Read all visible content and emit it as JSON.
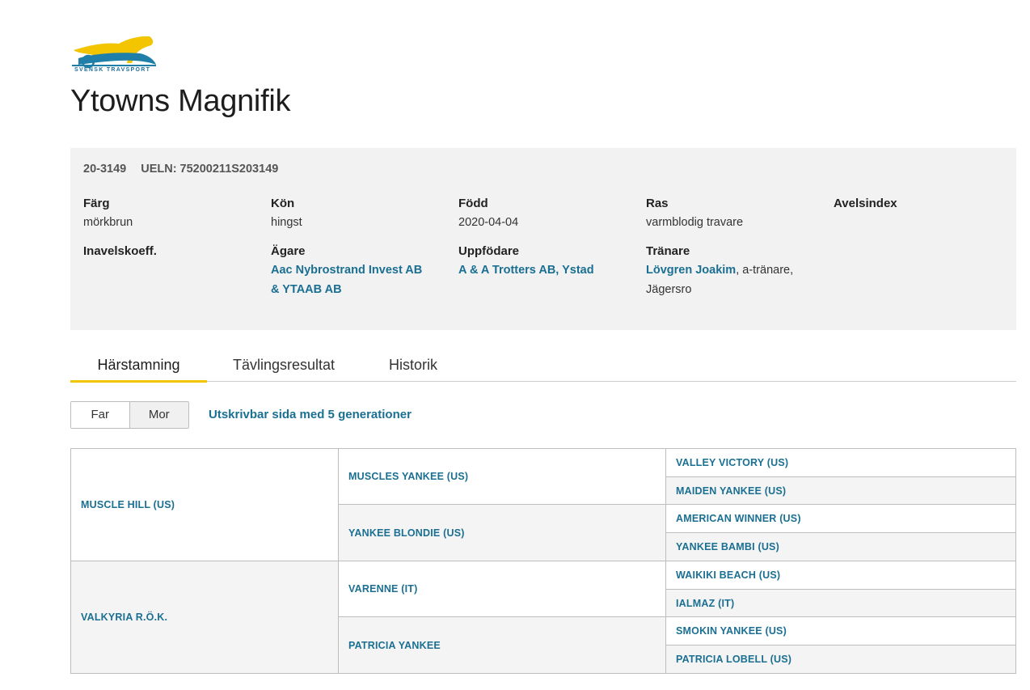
{
  "brand": {
    "logo_text": "SVENSK TRAVSPORT"
  },
  "horse": {
    "name": "Ytowns Magnifik",
    "reg_no": "20-3149",
    "ueln": "UELN: 75200211S203149",
    "fields": {
      "farg": {
        "label": "Färg",
        "value": "mörkbrun"
      },
      "kon": {
        "label": "Kön",
        "value": "hingst"
      },
      "fodd": {
        "label": "Född",
        "value": "2020-04-04"
      },
      "ras": {
        "label": "Ras",
        "value": "varmblodig travare"
      },
      "avelsindex": {
        "label": "Avelsindex"
      },
      "inavel": {
        "label": "Inavelskoeff."
      },
      "agare": {
        "label": "Ägare",
        "line1": "Aac Nybrostrand Invest AB",
        "line2": "& YTAAB AB"
      },
      "uppfodare": {
        "label": "Uppfödare",
        "value": "A & A Trotters AB, Ystad"
      },
      "tranare": {
        "label": "Tränare",
        "link": "Lövgren Joakim",
        "rest1": ", a-tränare,",
        "rest2": "Jägersro"
      }
    }
  },
  "tabs": [
    {
      "label": "Härstamning",
      "active": true
    },
    {
      "label": "Tävlingsresultat",
      "active": false
    },
    {
      "label": "Historik",
      "active": false
    }
  ],
  "toggle": {
    "far": "Far",
    "mor": "Mor"
  },
  "print_link": "Utskrivbar sida med 5 generationer",
  "pedigree": {
    "gen1": [
      "MUSCLE HILL (US)",
      "VALKYRIA R.Ö.K."
    ],
    "gen2": [
      "MUSCLES YANKEE (US)",
      "YANKEE BLONDIE (US)",
      "VARENNE (IT)",
      "PATRICIA YANKEE"
    ],
    "gen3": [
      "VALLEY VICTORY (US)",
      "MAIDEN YANKEE (US)",
      "AMERICAN WINNER (US)",
      "YANKEE BAMBI (US)",
      "WAIKIKI BEACH (US)",
      "IALMAZ (IT)",
      "SMOKIN YANKEE (US)",
      "PATRICIA LOBELL (US)"
    ]
  },
  "colors": {
    "link": "#1a6f92",
    "accent": "#f2c500",
    "panel": "#f2f2f2"
  }
}
